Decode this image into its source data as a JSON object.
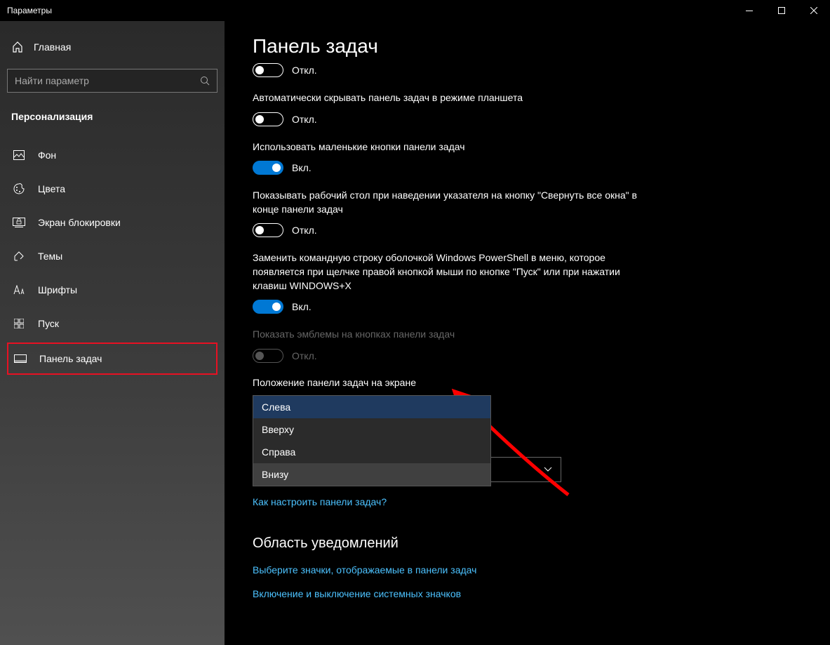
{
  "window": {
    "title": "Параметры"
  },
  "sidebar": {
    "home": "Главная",
    "search_placeholder": "Найти параметр",
    "section": "Персонализация",
    "items": [
      {
        "label": "Фон",
        "icon": "background-icon"
      },
      {
        "label": "Цвета",
        "icon": "colors-icon"
      },
      {
        "label": "Экран блокировки",
        "icon": "lockscreen-icon"
      },
      {
        "label": "Темы",
        "icon": "themes-icon"
      },
      {
        "label": "Шрифты",
        "icon": "fonts-icon"
      },
      {
        "label": "Пуск",
        "icon": "start-icon"
      },
      {
        "label": "Панель задач",
        "icon": "taskbar-icon",
        "active": true
      }
    ]
  },
  "page": {
    "title": "Панель задач",
    "settings": [
      {
        "label": "",
        "state_label": "Откл.",
        "on": false
      },
      {
        "label": "Автоматически скрывать панель задач в режиме планшета",
        "state_label": "Откл.",
        "on": false
      },
      {
        "label": "Использовать маленькие кнопки панели задач",
        "state_label": "Вкл.",
        "on": true
      },
      {
        "label": "Показывать рабочий стол при наведении указателя на кнопку \"Свернуть все окна\" в конце панели задач",
        "state_label": "Откл.",
        "on": false
      },
      {
        "label": "Заменить командную строку оболочкой Windows PowerShell в меню, которое появляется при щелчке правой кнопкой мыши по кнопке \"Пуск\" или при нажатии клавиш WINDOWS+X",
        "state_label": "Вкл.",
        "on": true
      },
      {
        "label": "Показать эмблемы на кнопках панели задач",
        "state_label": "Откл.",
        "on": false,
        "disabled": true
      }
    ],
    "dropdown": {
      "label": "Положение панели задач на экране",
      "options": [
        "Слева",
        "Вверху",
        "Справа",
        "Внизу"
      ],
      "selected": "Слева",
      "hover": "Внизу"
    },
    "link1": "Как настроить панели задач?",
    "section2": "Область уведомлений",
    "link2": "Выберите значки, отображаемые в панели задач",
    "link3": "Включение и выключение системных значков"
  }
}
